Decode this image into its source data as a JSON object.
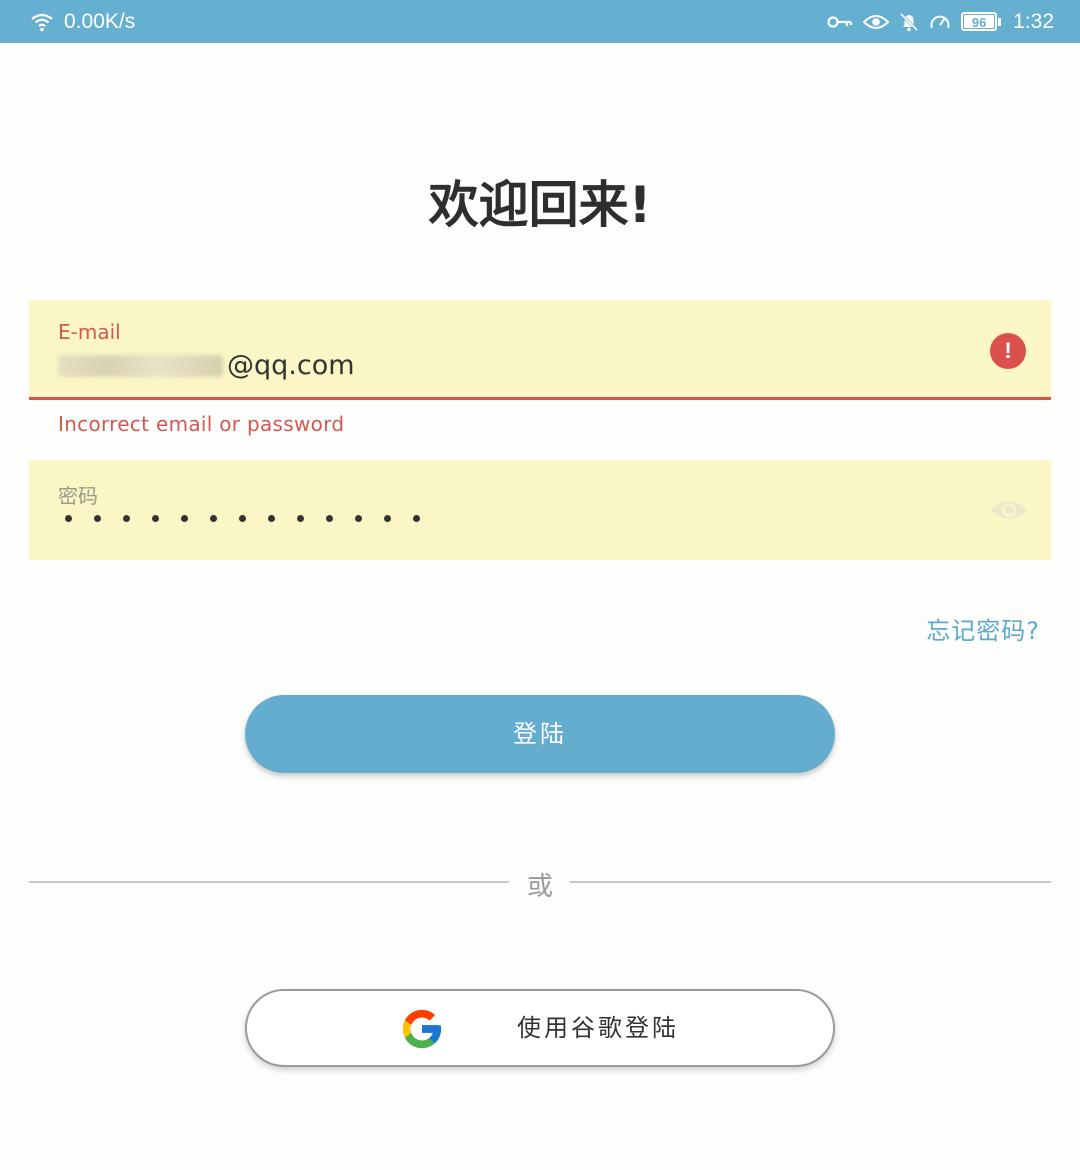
{
  "status_bar": {
    "network_speed": "0.00K/s",
    "battery": "96",
    "time": "1:32",
    "icons": [
      "wifi-icon",
      "key-icon",
      "eye-icon",
      "bell-off-icon",
      "speedometer-icon",
      "battery-icon"
    ]
  },
  "title": "欢迎回来!",
  "email_field": {
    "label": "E-mail",
    "value_visible": "@qq.com",
    "error_icon": "!",
    "error_text": "Incorrect email or password"
  },
  "password_field": {
    "label": "密码",
    "dot_count": 13
  },
  "forgot_password": "忘记密码?",
  "login_button": "登陆",
  "divider_text": "或",
  "google_button": "使用谷歌登陆",
  "colors": {
    "accent": "#64adcf",
    "field_bg": "#fbf6c5",
    "error": "#d9504c",
    "status_bar": "#65afd0"
  }
}
